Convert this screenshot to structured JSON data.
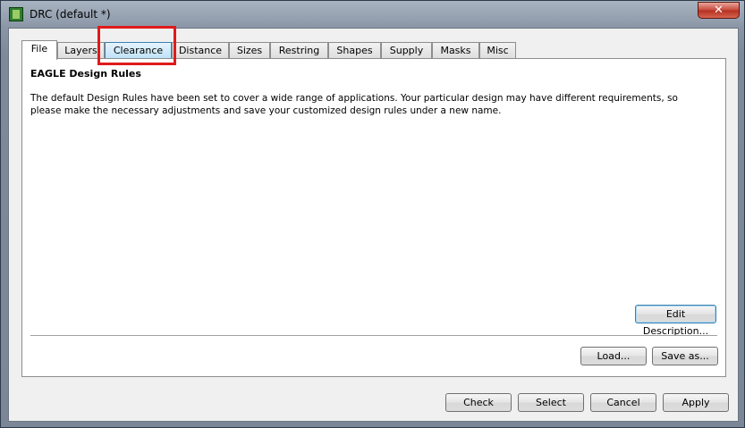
{
  "window": {
    "title": "DRC (default *)",
    "close_label": "✕"
  },
  "tabs": [
    {
      "label": "File"
    },
    {
      "label": "Layers"
    },
    {
      "label": "Clearance"
    },
    {
      "label": "Distance"
    },
    {
      "label": "Sizes"
    },
    {
      "label": "Restring"
    },
    {
      "label": "Shapes"
    },
    {
      "label": "Supply"
    },
    {
      "label": "Masks"
    },
    {
      "label": "Misc"
    }
  ],
  "panel": {
    "title": "EAGLE Design Rules",
    "description": "The default Design Rules have been set to cover a wide range of applications. Your particular design may have different requirements, so please make the necessary adjustments and save your customized design rules under a new name.",
    "edit_description_label": "Edit Description...",
    "load_label": "Load...",
    "save_as_label": "Save as..."
  },
  "footer": {
    "check_label": "Check",
    "select_label": "Select",
    "cancel_label": "Cancel",
    "apply_label": "Apply"
  },
  "colors": {
    "highlight": "#e01a1a",
    "close": "#c8473a"
  }
}
